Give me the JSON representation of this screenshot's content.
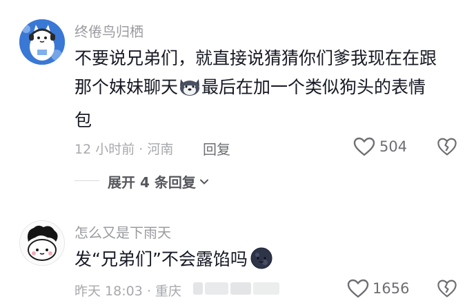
{
  "comments": [
    {
      "username": "终倦鸟归栖",
      "content_line1": "不要说兄弟们，就直接说猜猜你们爹我现在在跟",
      "content_line2_a": "那个妹妹聊天",
      "content_line2_b": "最后在加一个类似狗头的表情",
      "content_line3": "包",
      "meta": "12 小时前 · 河南",
      "reply_label": "回复",
      "like_count": "504",
      "expand_label": "展开 4 条回复"
    },
    {
      "username": "怎么又是下雨天",
      "content_text": "发“兄弟们”不会露馅吗",
      "meta": "昨天 18:03 · 重庆",
      "like_count": "1656"
    }
  ],
  "colors": {
    "heart": "#6d6e73",
    "meta": "#a7a8ad",
    "username": "#9a9ba0",
    "avatar1_bg": "#2f6fd1"
  }
}
